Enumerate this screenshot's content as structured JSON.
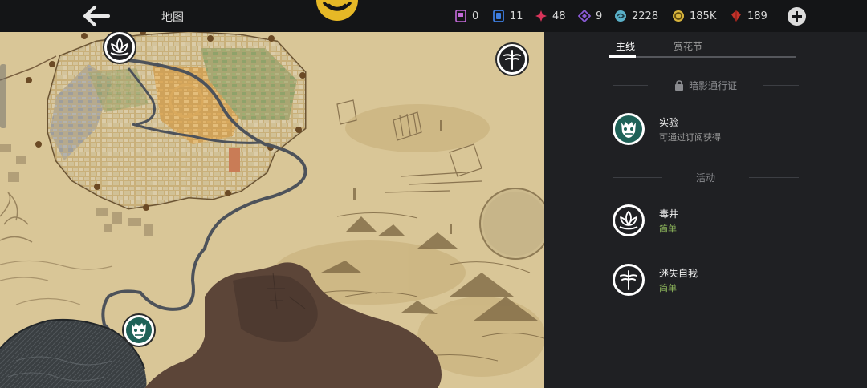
{
  "header": {
    "title": "地图",
    "resources": [
      {
        "name": "pass-card",
        "value": "0",
        "color": "#c46ad9"
      },
      {
        "name": "blue-card",
        "value": "11",
        "color": "#3d7de0"
      },
      {
        "name": "red-star",
        "value": "48",
        "color": "#d8345a"
      },
      {
        "name": "purple-gem",
        "value": "9",
        "color": "#8a5ad6"
      },
      {
        "name": "cyan-swirl",
        "value": "2228",
        "color": "#5ab0c8"
      },
      {
        "name": "gold-coin",
        "value": "185K",
        "color": "#d8b43c"
      },
      {
        "name": "red-crystal",
        "value": "189",
        "color": "#c4322a"
      }
    ]
  },
  "panel": {
    "tabs": [
      "主线",
      "赏花节"
    ],
    "sections": {
      "locked": "暗影通行证",
      "activity": "活动"
    },
    "quests": [
      {
        "name": "实验",
        "subtitle": "可通过订阅获得",
        "icon": "demon-mask-icon",
        "subtitle_color": "#9a9a9a"
      },
      {
        "name": "毒井",
        "subtitle": "简单",
        "icon": "lotus-icon",
        "subtitle_color": "#8bb35a"
      },
      {
        "name": "迷失自我",
        "subtitle": "简单",
        "icon": "dragonfly-icon",
        "subtitle_color": "#8bb35a"
      }
    ]
  },
  "colors": {
    "teal_marker": "#1f6258",
    "difficulty_easy": "#8bb35a"
  }
}
